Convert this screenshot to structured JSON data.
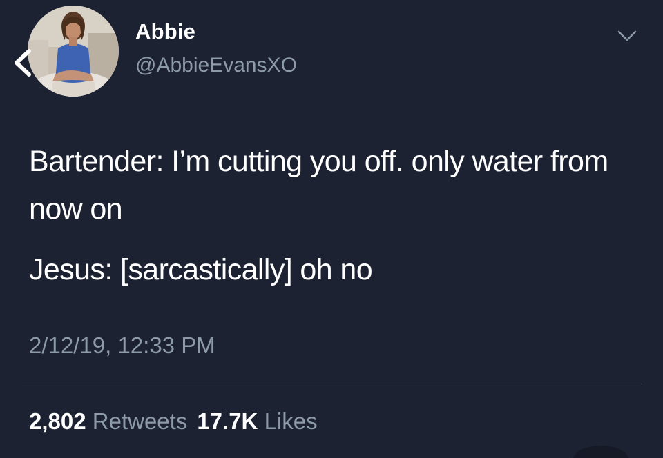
{
  "user": {
    "display_name": "Abbie",
    "handle": "@AbbieEvansXO"
  },
  "tweet": {
    "line1": "Bartender: I’m cutting you off. only water from now on",
    "line2": "Jesus: [sarcastically] oh no",
    "timestamp": "2/12/19, 12:33 PM"
  },
  "stats": {
    "retweets_count": "2,802",
    "retweets_label": "Retweets",
    "likes_count": "17.7K",
    "likes_label": "Likes"
  },
  "colors": {
    "background": "#1c2232",
    "secondary_text": "#8d9aa8",
    "primary_text": "#ffffff",
    "divider": "#38414f"
  },
  "icons": {
    "back": "chevron-left-icon",
    "menu": "chevron-down-icon"
  }
}
